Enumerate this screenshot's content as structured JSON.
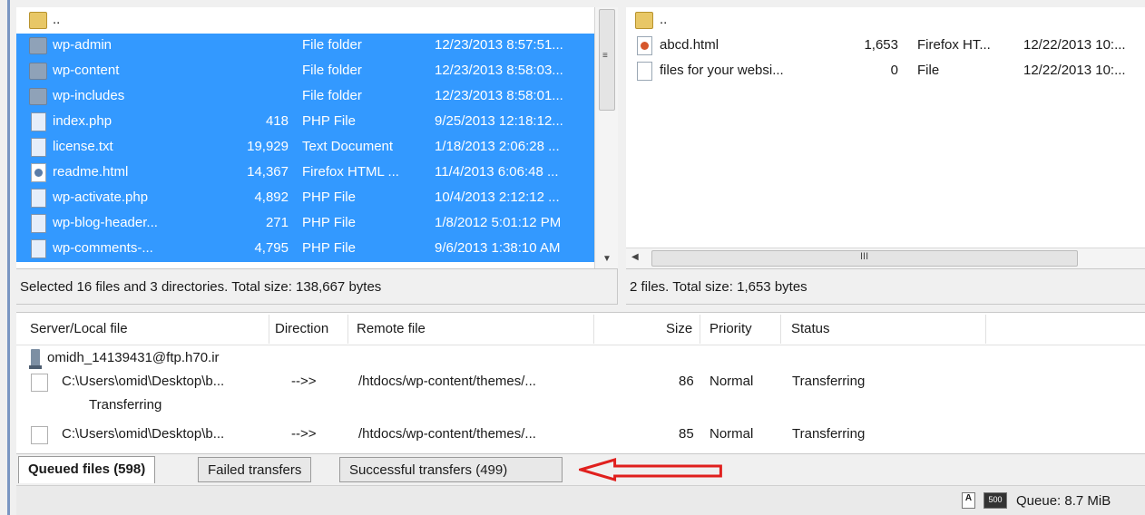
{
  "local": {
    "rows": [
      {
        "name": "..",
        "size": "",
        "type": "",
        "modified": "",
        "icon": "folder-icon",
        "selected": false
      },
      {
        "name": "wp-admin",
        "size": "",
        "type": "File folder",
        "modified": "12/23/2013 8:57:51...",
        "icon": "folder-icon",
        "selected": true
      },
      {
        "name": "wp-content",
        "size": "",
        "type": "File folder",
        "modified": "12/23/2013 8:58:03...",
        "icon": "folder-icon",
        "selected": true
      },
      {
        "name": "wp-includes",
        "size": "",
        "type": "File folder",
        "modified": "12/23/2013 8:58:01...",
        "icon": "folder-icon",
        "selected": true
      },
      {
        "name": "index.php",
        "size": "418",
        "type": "PHP File",
        "modified": "9/25/2013 12:18:12...",
        "icon": "file-icon",
        "selected": true
      },
      {
        "name": "license.txt",
        "size": "19,929",
        "type": "Text Document",
        "modified": "1/18/2013 2:06:28 ...",
        "icon": "file-icon",
        "selected": true
      },
      {
        "name": "readme.html",
        "size": "14,367",
        "type": "Firefox HTML ...",
        "modified": "11/4/2013 6:06:48 ...",
        "icon": "html-icon",
        "selected": true
      },
      {
        "name": "wp-activate.php",
        "size": "4,892",
        "type": "PHP File",
        "modified": "10/4/2013 2:12:12 ...",
        "icon": "file-icon",
        "selected": true
      },
      {
        "name": "wp-blog-header...",
        "size": "271",
        "type": "PHP File",
        "modified": "1/8/2012 5:01:12 PM",
        "icon": "file-icon",
        "selected": true
      },
      {
        "name": "wp-comments-...",
        "size": "4,795",
        "type": "PHP File",
        "modified": "9/6/2013 1:38:10 AM",
        "icon": "file-icon",
        "selected": true
      }
    ],
    "status": "Selected 16 files and 3 directories. Total size: 138,667 bytes"
  },
  "remote": {
    "rows": [
      {
        "name": "..",
        "size": "",
        "type": "",
        "modified": "",
        "icon": "folder-icon"
      },
      {
        "name": "abcd.html",
        "size": "1,653",
        "type": "Firefox HT...",
        "modified": "12/22/2013 10:...",
        "icon": "html-icon"
      },
      {
        "name": "files for your websi...",
        "size": "0",
        "type": "File",
        "modified": "12/22/2013 10:...",
        "icon": "file-icon"
      }
    ],
    "status": "2 files. Total size: 1,653 bytes",
    "scroll_grip": "III"
  },
  "queue": {
    "headers": {
      "server_local": "Server/Local file",
      "direction": "Direction",
      "remote": "Remote file",
      "size": "Size",
      "priority": "Priority",
      "status": "Status"
    },
    "server": "omidh_14139431@ftp.h70.ir",
    "items": [
      {
        "local": "C:\\Users\\omid\\Desktop\\b...",
        "direction": "-->>",
        "remote": "/htdocs/wp-content/themes/...",
        "size": "86",
        "priority": "Normal",
        "status": "Transferring",
        "sub": "Transferring"
      },
      {
        "local": "C:\\Users\\omid\\Desktop\\b...",
        "direction": "-->>",
        "remote": "/htdocs/wp-content/themes/...",
        "size": "85",
        "priority": "Normal",
        "status": "Transferring",
        "sub": ""
      }
    ]
  },
  "tabs": {
    "queued": "Queued files (598)",
    "failed": "Failed transfers",
    "successful": "Successful transfers (499)"
  },
  "statusbar": {
    "queue": "Queue: 8.7 MiB",
    "speed_icon_label": "500"
  },
  "colors": {
    "selection": "#3399ff",
    "annotation_arrow": "#e0201e"
  }
}
